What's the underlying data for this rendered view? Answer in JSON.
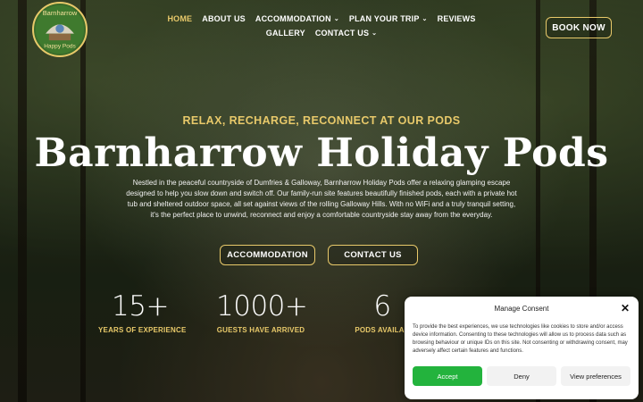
{
  "colors": {
    "accent": "#e8c96a",
    "accept": "#23b33d"
  },
  "logo": {
    "text_top": "Barnharrow",
    "text_bottom": "Happy Pods"
  },
  "nav": {
    "items": [
      {
        "label": "HOME",
        "active": true
      },
      {
        "label": "ABOUT US"
      },
      {
        "label": "ACCOMMODATION",
        "caret": "⌄"
      },
      {
        "label": "PLAN YOUR TRIP",
        "caret": "⌄"
      },
      {
        "label": "REVIEWS"
      },
      {
        "label": "GALLERY"
      },
      {
        "label": "CONTACT US",
        "caret": "⌄"
      }
    ],
    "book_now": "BOOK NOW"
  },
  "hero": {
    "tagline": "RELAX, RECHARGE, RECONNECT AT OUR PODS",
    "title": "Barnharrow Holiday Pods",
    "description": "Nestled in the peaceful countryside of Dumfries & Galloway, Barnharrow Holiday Pods offer a relaxing glamping escape designed to help you slow down and switch off. Our family-run site features beautifully finished pods, each with a private hot tub and sheltered outdoor space, all set against views of the rolling Galloway Hills. With no WiFi and a truly tranquil setting, it's the perfect place to unwind, reconnect and enjoy a comfortable countryside stay away from the everyday.",
    "btn_accommodation": "ACCOMMODATION",
    "btn_contact": "CONTACT US"
  },
  "stats": [
    {
      "number": "15+",
      "label": "YEARS OF EXPERIENCE"
    },
    {
      "number": "1000+",
      "label": "GUESTS HAVE ARRIVED"
    },
    {
      "number": "6",
      "label": "PODS AVAILAB"
    }
  ],
  "consent": {
    "title": "Manage Consent",
    "close": "✕",
    "text": "To provide the best experiences, we use technologies like cookies to store and/or access device information. Consenting to these technologies will allow us to process data such as browsing behaviour or unique IDs on this site. Not consenting or withdrawing consent, may adversely affect certain features and functions.",
    "accept": "Accept",
    "deny": "Deny",
    "preferences": "View preferences"
  }
}
